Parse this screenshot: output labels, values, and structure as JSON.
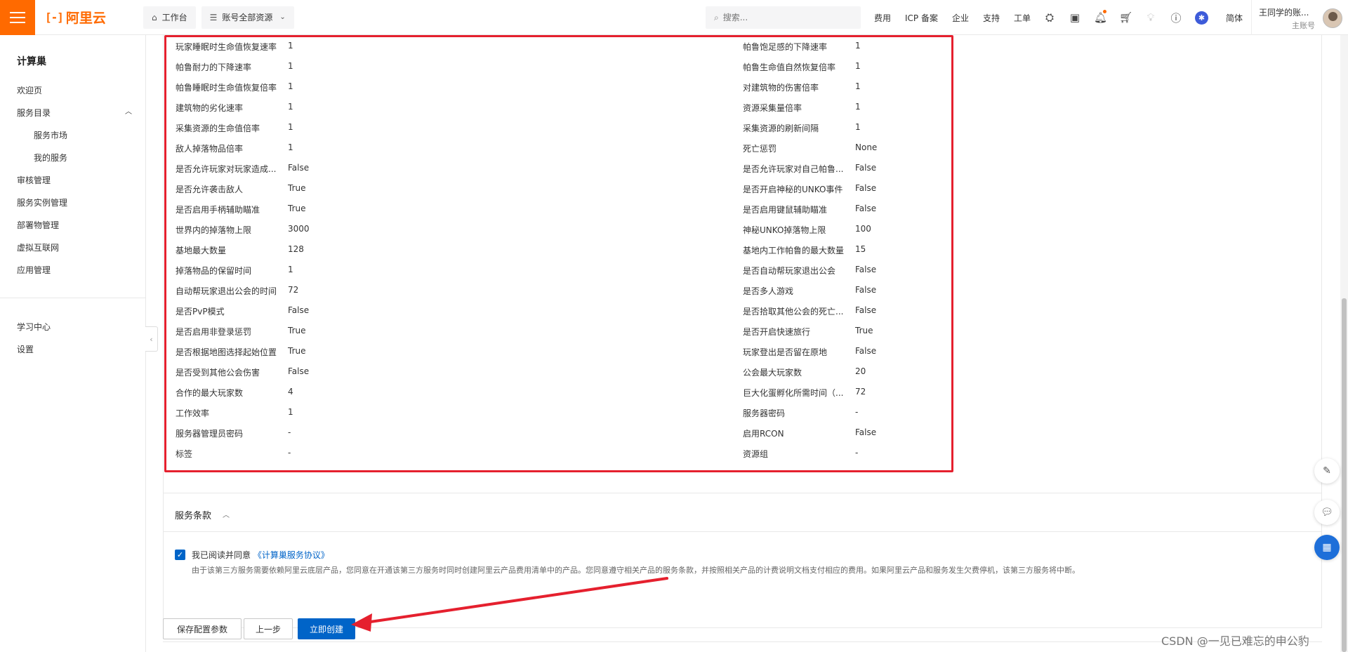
{
  "topbar": {
    "logo_text": "阿里云",
    "workbench": "工作台",
    "resource_scope": "账号全部资源",
    "search_placeholder": "搜索...",
    "links": [
      "费用",
      "ICP 备案",
      "企业",
      "支持",
      "工单"
    ],
    "language": "简体",
    "user_name": "王同学的账...",
    "user_role": "主账号"
  },
  "sidebar": {
    "title": "计算巢",
    "items": [
      {
        "label": "欢迎页",
        "sub": false
      },
      {
        "label": "服务目录",
        "sub": false
      },
      {
        "label": "服务市场",
        "sub": true
      },
      {
        "label": "我的服务",
        "sub": true
      },
      {
        "label": "审核管理",
        "sub": false
      },
      {
        "label": "服务实例管理",
        "sub": false
      },
      {
        "label": "部署物管理",
        "sub": false
      },
      {
        "label": "虚拟互联网",
        "sub": false
      },
      {
        "label": "应用管理",
        "sub": false
      }
    ],
    "bottom_items": [
      "学习中心",
      "设置"
    ]
  },
  "params_left": [
    [
      "玩家睡眠时生命值恢复速率",
      "1"
    ],
    [
      "帕鲁耐力的下降速率",
      "1"
    ],
    [
      "帕鲁睡眠时生命值恢复倍率",
      "1"
    ],
    [
      "建筑物的劣化速率",
      "1"
    ],
    [
      "采集资源的生命值倍率",
      "1"
    ],
    [
      "敌人掉落物品倍率",
      "1"
    ],
    [
      "是否允许玩家对玩家造成...",
      "False"
    ],
    [
      "是否允许袭击敌人",
      "True"
    ],
    [
      "是否启用手柄辅助瞄准",
      "True"
    ],
    [
      "世界内的掉落物上限",
      "3000"
    ],
    [
      "基地最大数量",
      "128"
    ],
    [
      "掉落物品的保留时间",
      "1"
    ],
    [
      "自动帮玩家退出公会的时间",
      "72"
    ],
    [
      "是否PvP模式",
      "False"
    ],
    [
      "是否启用非登录惩罚",
      "True"
    ],
    [
      "是否根据地图选择起始位置",
      "True"
    ],
    [
      "是否受到其他公会伤害",
      "False"
    ],
    [
      "合作的最大玩家数",
      "4"
    ],
    [
      "工作效率",
      "1"
    ],
    [
      "服务器管理员密码",
      "-"
    ],
    [
      "标签",
      "-"
    ]
  ],
  "params_right": [
    [
      "帕鲁饱足感的下降速率",
      "1"
    ],
    [
      "帕鲁生命值自然恢复倍率",
      "1"
    ],
    [
      "对建筑物的伤害倍率",
      "1"
    ],
    [
      "资源采集量倍率",
      "1"
    ],
    [
      "采集资源的刷新间隔",
      "1"
    ],
    [
      "死亡惩罚",
      "None"
    ],
    [
      "是否允许玩家对自己帕鲁...",
      "False"
    ],
    [
      "是否开启神秘的UNKO事件",
      "False"
    ],
    [
      "是否启用键鼠辅助瞄准",
      "False"
    ],
    [
      "神秘UNKO掉落物上限",
      "100"
    ],
    [
      "基地内工作帕鲁的最大数量",
      "15"
    ],
    [
      "是否自动帮玩家退出公会",
      "False"
    ],
    [
      "是否多人游戏",
      "False"
    ],
    [
      "是否拾取其他公会的死亡...",
      "False"
    ],
    [
      "是否开启快速旅行",
      "True"
    ],
    [
      "玩家登出是否留在原地",
      "False"
    ],
    [
      "公会最大玩家数",
      "20"
    ],
    [
      "巨大化蛋孵化所需时间（...",
      "72"
    ],
    [
      "服务器密码",
      "-"
    ],
    [
      "启用RCON",
      "False"
    ],
    [
      "资源组",
      "-"
    ]
  ],
  "terms": {
    "title": "服务条款",
    "agree_prefix": "我已阅读并同意",
    "agree_link": "《计算巢服务协议》",
    "description": "由于该第三方服务需要依赖阿里云底层产品，您同意在开通该第三方服务时同时创建阿里云产品费用清单中的产品。您同意遵守相关产品的服务条款，并按照相关产品的计费说明文档支付相应的费用。如果阿里云产品和服务发生欠费停机，该第三方服务将中断。"
  },
  "buttons": {
    "save_params": "保存配置参数",
    "prev": "上一步",
    "create": "立即创建"
  },
  "watermark": "CSDN @一见已难忘的申公豹",
  "colors": {
    "brand": "#ff6a00",
    "primary": "#0064c8",
    "annotation": "#e5202e"
  }
}
